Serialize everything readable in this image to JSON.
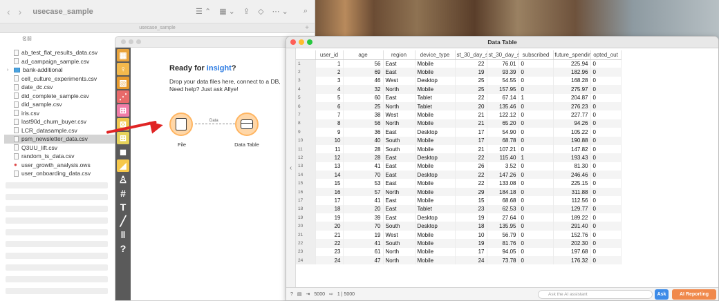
{
  "finder": {
    "title": "usecase_sample",
    "path_label": "usecase_sample",
    "col_header": "名前",
    "files": [
      {
        "name": "ab_test_flat_results_data.csv",
        "kind": "file"
      },
      {
        "name": "ad_campaign_sample.csv",
        "kind": "file"
      },
      {
        "name": "bank-additional",
        "kind": "folder"
      },
      {
        "name": "cell_culture_experiments.csv",
        "kind": "file"
      },
      {
        "name": "date_dc.csv",
        "kind": "file"
      },
      {
        "name": "did_complete_sample.csv",
        "kind": "file"
      },
      {
        "name": "did_sample.csv",
        "kind": "file"
      },
      {
        "name": "iris.csv",
        "kind": "file"
      },
      {
        "name": "last90d_churn_buyer.csv",
        "kind": "file"
      },
      {
        "name": "LCR_datasample.csv",
        "kind": "file"
      },
      {
        "name": "psm_newsletter_data.csv",
        "kind": "file",
        "selected": true
      },
      {
        "name": "Q3UU_lift.csv",
        "kind": "file"
      },
      {
        "name": "random_ts_data.csv",
        "kind": "file"
      },
      {
        "name": "user_growth_analysis.ows",
        "kind": "ows"
      },
      {
        "name": "user_onboarding_data.csv",
        "kind": "file"
      }
    ]
  },
  "orange": {
    "ready_prefix": "Ready for ",
    "ready_word": "insight",
    "ready_suffix": "?",
    "hint_line1": "Drop your data files here, connect to a DB,",
    "hint_line2": "Need help? Just ask Allye!",
    "node_file_label": "File",
    "node_table_label": "Data Table",
    "link_label": "Data",
    "tool_colors": [
      "#e8a33b",
      "#f3b94d",
      "#e79a2d",
      "#e86a6a",
      "#f07ca7",
      "#f1c74e",
      "#e6d25a",
      "#5a5a5a",
      "#f6c84b"
    ]
  },
  "table": {
    "window_title": "Data Table",
    "columns": [
      "user_id",
      "age",
      "region",
      "device_type",
      "st_30_day_sessic",
      "st_30_day_spend",
      "subscribed",
      "future_spending",
      "opted_out"
    ],
    "rows": [
      [
        1,
        56,
        "East",
        "Mobile",
        22,
        "76.01",
        "0",
        "225.94",
        "0"
      ],
      [
        2,
        69,
        "East",
        "Mobile",
        19,
        "93.39",
        "0",
        "182.96",
        "0"
      ],
      [
        3,
        46,
        "West",
        "Desktop",
        25,
        "54.55",
        "0",
        "168.28",
        "0"
      ],
      [
        4,
        32,
        "North",
        "Mobile",
        25,
        "157.95",
        "0",
        "275.97",
        "0"
      ],
      [
        5,
        60,
        "East",
        "Tablet",
        22,
        "67.14",
        "1",
        "204.87",
        "0"
      ],
      [
        6,
        25,
        "North",
        "Tablet",
        20,
        "135.46",
        "0",
        "276.23",
        "0"
      ],
      [
        7,
        38,
        "West",
        "Mobile",
        21,
        "122.12",
        "0",
        "227.77",
        "0"
      ],
      [
        8,
        56,
        "North",
        "Mobile",
        21,
        "65.20",
        "0",
        "94.26",
        "0"
      ],
      [
        9,
        36,
        "East",
        "Desktop",
        17,
        "54.90",
        "0",
        "105.22",
        "0"
      ],
      [
        10,
        40,
        "South",
        "Mobile",
        17,
        "68.78",
        "0",
        "190.88",
        "0"
      ],
      [
        11,
        28,
        "South",
        "Mobile",
        21,
        "107.21",
        "0",
        "147.82",
        "0"
      ],
      [
        12,
        28,
        "East",
        "Desktop",
        22,
        "115.40",
        "1",
        "193.43",
        "0"
      ],
      [
        13,
        41,
        "East",
        "Mobile",
        26,
        "3.52",
        "0",
        "81.30",
        "0"
      ],
      [
        14,
        70,
        "East",
        "Desktop",
        22,
        "147.26",
        "0",
        "246.46",
        "0"
      ],
      [
        15,
        53,
        "East",
        "Mobile",
        22,
        "133.08",
        "0",
        "225.15",
        "0"
      ],
      [
        16,
        57,
        "North",
        "Mobile",
        29,
        "184.18",
        "0",
        "311.88",
        "0"
      ],
      [
        17,
        41,
        "East",
        "Mobile",
        15,
        "68.68",
        "0",
        "112.56",
        "0"
      ],
      [
        18,
        20,
        "East",
        "Tablet",
        23,
        "62.53",
        "0",
        "129.77",
        "0"
      ],
      [
        19,
        39,
        "East",
        "Desktop",
        19,
        "27.64",
        "0",
        "189.22",
        "0"
      ],
      [
        20,
        70,
        "South",
        "Desktop",
        18,
        "135.95",
        "0",
        "291.40",
        "0"
      ],
      [
        21,
        19,
        "West",
        "Mobile",
        10,
        "56.79",
        "0",
        "152.76",
        "0"
      ],
      [
        22,
        41,
        "South",
        "Mobile",
        19,
        "81.76",
        "0",
        "202.30",
        "0"
      ],
      [
        23,
        61,
        "North",
        "Mobile",
        17,
        "94.05",
        "0",
        "197.68",
        "0"
      ],
      [
        24,
        47,
        "North",
        "Mobile",
        24,
        "73.78",
        "0",
        "176.32",
        "0"
      ]
    ],
    "footer_rows": "5000",
    "footer_sel": "1 | 5000",
    "ai_placeholder": "Ask the AI assistant",
    "ask_label": "Ask",
    "ai_reporting_label": "AI Reporting"
  }
}
